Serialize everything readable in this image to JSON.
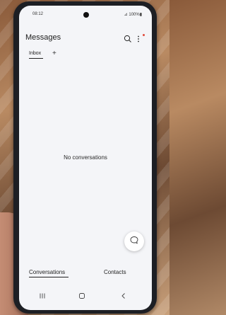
{
  "status_bar": {
    "time": "08:12",
    "indicators": "⊿ 100%▮"
  },
  "app": {
    "title": "Messages",
    "tabs": [
      {
        "label": "Inbox",
        "selected": true
      }
    ],
    "add_tab_symbol": "+",
    "empty_message": "No conversations",
    "icons": {
      "search": "search-icon",
      "more": "more-vertical-icon",
      "compose": "compose-chat-icon"
    }
  },
  "bottom_tabs": [
    {
      "label": "Conversations",
      "selected": true
    },
    {
      "label": "Contacts",
      "selected": false
    }
  ],
  "system_nav": {
    "recents": "recents-icon",
    "home": "home-icon",
    "back": "back-icon"
  },
  "colors": {
    "screen_bg": "#f4f5f8",
    "notification_dot": "#e14b3b"
  }
}
